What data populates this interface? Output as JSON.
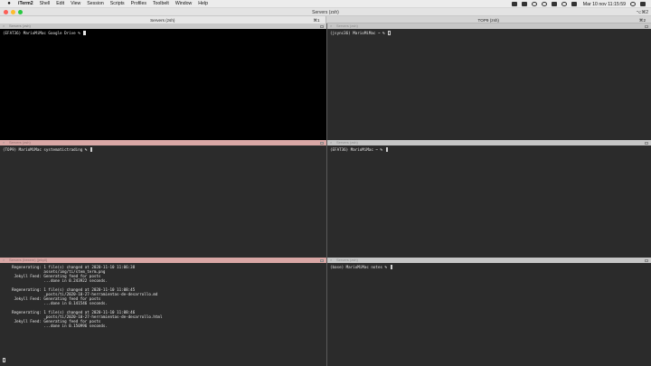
{
  "menubar": {
    "app_name": "iTerm2",
    "items": [
      "Shell",
      "Edit",
      "View",
      "Session",
      "Scripts",
      "Profiles",
      "Toolbelt",
      "Window",
      "Help"
    ],
    "clock": "Mar 10 nov  11:15:59"
  },
  "window": {
    "title": "Servers (zsh)",
    "shortcut": "⌥⌘2"
  },
  "tabs": [
    {
      "label": "Servers (zsh)",
      "shortcut": "⌘1",
      "active": true
    },
    {
      "label": "TOP9 (zsh)",
      "shortcut": "⌘2",
      "active": false
    }
  ],
  "panes": {
    "top_left": {
      "title": "Servers (zsh)",
      "prompt": "(EFAT36) MarioMiMac Google Drive % "
    },
    "top_right": {
      "title": "Servers (zsh)",
      "prompt": "(jsync36) MarioMiMac ~ % "
    },
    "mid_left": {
      "title": "Servers (zsh)",
      "prompt": "(TOP9) MarioMiMac systematictrading % "
    },
    "mid_right": {
      "title": "Servers (zsh)",
      "prompt": "(EFAT36) MarioMiMac ~ % "
    },
    "bottom_left": {
      "title": "Servers (bexem) (jekyll)",
      "lines": [
        "    Regenerating: 1 file(s) changed at 2020-11-10 11:06:38",
        "                  assets/img/ti/stem_term.png",
        "     Jekyll Feed: Generating feed for posts",
        "                  ...done in 0.243922 seconds.",
        "",
        "    Regenerating: 1 file(s) changed at 2020-11-10 11:08:45",
        "                  _posts/ti/2020-10-27-herramientas-de-desarrollo.md",
        "     Jekyll Feed: Generating feed for posts",
        "                  ...done in 0.141546 seconds.",
        "",
        "    Regenerating: 1 file(s) changed at 2020-11-10 11:08:46",
        "                  _posts/ti/2020-10-27-herramientas-de-desarrollo.html",
        "     Jekyll Feed: Generating feed for posts",
        "                  ...done in 0.150996 seconds."
      ]
    },
    "bottom_right": {
      "title": "Servers (zsh)",
      "prompt": "(base) MarioMiMac notes % "
    }
  }
}
